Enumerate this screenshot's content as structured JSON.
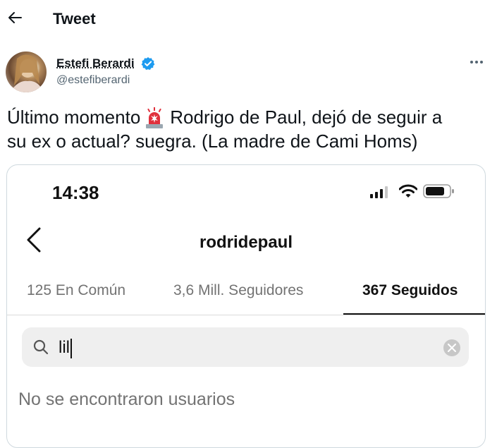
{
  "header": {
    "title": "Tweet",
    "back_icon": "arrow-left-icon"
  },
  "author": {
    "name": "Estefi Berardi",
    "handle": "@estefiberardi",
    "verified": true,
    "verified_color": "#1d9bf0"
  },
  "tweet": {
    "line1_before": "Último momento",
    "line1_after": "Rodrigo de Paul, dejó de seguir a",
    "line2": "su ex o actual? suegra. (La madre de Cami Homs)",
    "emoji": "police-siren-icon"
  },
  "phone": {
    "status_bar": {
      "time": "14:38"
    },
    "profile": {
      "username": "rodridepaul"
    },
    "tabs": [
      {
        "label": "125 En Común"
      },
      {
        "label": "3,6 Mill. Seguidores"
      },
      {
        "label": "367 Seguidos",
        "active": true
      }
    ],
    "search": {
      "value": "lil"
    },
    "empty_message": "No se encontraron usuarios"
  }
}
